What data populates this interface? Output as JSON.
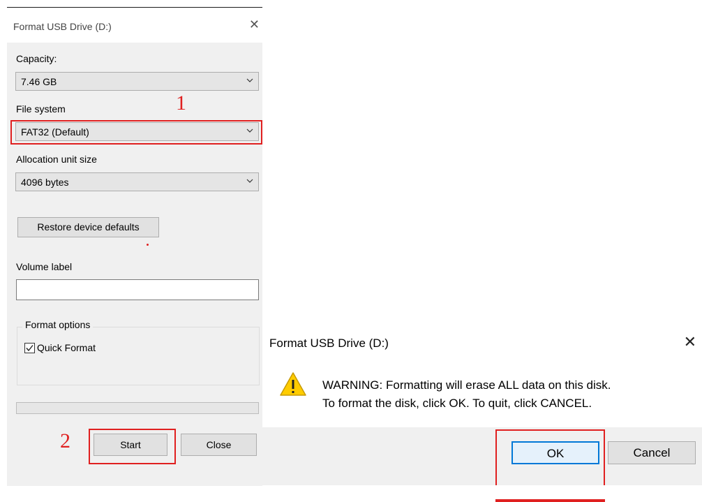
{
  "format_dialog": {
    "title": "Format USB Drive (D:)",
    "close_glyph": "✕",
    "capacity_label": "Capacity:",
    "capacity_value": "7.46 GB",
    "filesystem_label": "File system",
    "filesystem_value": "FAT32 (Default)",
    "allocation_label": "Allocation unit size",
    "allocation_value": "4096 bytes",
    "restore_button": "Restore device defaults",
    "volume_label": "Volume label",
    "volume_value": "",
    "format_options_label": "Format options",
    "quick_format_label": "Quick Format",
    "quick_format_checked": true,
    "progress": 0,
    "start_button": "Start",
    "close_button": "Close"
  },
  "annotations": {
    "step1": "1",
    "step2": "2",
    "color": "#e02020"
  },
  "warning_dialog": {
    "title": "Format USB Drive (D:)",
    "close_glyph": "✕",
    "icon": "warning-icon",
    "line1": "WARNING: Formatting will erase ALL data on this disk.",
    "line2": "To format the disk, click OK. To quit, click CANCEL.",
    "ok_button": "OK",
    "cancel_button": "Cancel"
  }
}
